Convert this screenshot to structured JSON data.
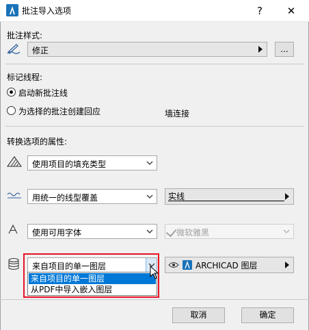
{
  "title": "批注导入选项",
  "title_help": "?",
  "title_close": "✕",
  "style_section": {
    "label": "批注样式:",
    "style_value": "修正",
    "more_button": "..."
  },
  "mark_section": {
    "label": "标记线程:",
    "radio_new": "启动新批注线",
    "radio_reply": "为选择的批注创建回应",
    "wall_connect": "墙连接",
    "selected": "radio_new"
  },
  "convert_section": {
    "label": "转换选项的属性:",
    "fill_dropdown": "使用项目的填充类型",
    "line_dropdown": "用统一的线型覆盖",
    "line_popup": "实线",
    "font_dropdown": "使用可用字体",
    "font_popup": "微软雅黑",
    "layer_dropdown": "来自项目的单一图层",
    "layer_popup": "ARCHICAD 图层",
    "layer_options": [
      "来自项目的单一图层",
      "从PDF中导入嵌入图层"
    ]
  },
  "footer": {
    "cancel": "取消",
    "ok": "确定"
  },
  "colors": {
    "highlight": "#0078d7",
    "red_outline": "#e81123",
    "dialog_bg": "#f0f0f0"
  }
}
